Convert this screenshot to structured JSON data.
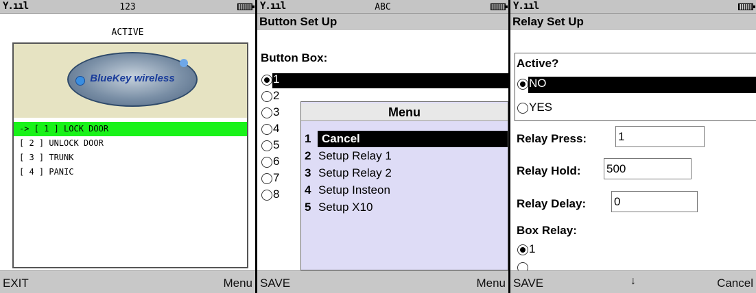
{
  "screens": [
    {
      "mode": "123",
      "title": "ACTIVE",
      "logo_text": "BlueKey wireless",
      "items": [
        "-> [ 1 ] LOCK DOOR",
        "[ 2 ] UNLOCK DOOR",
        "[ 3 ] TRUNK",
        "[ 4 ] PANIC"
      ],
      "softkeys": {
        "left": "EXIT",
        "right": "Menu"
      }
    },
    {
      "mode": "ABC",
      "header": "Button Set Up",
      "label": "Button Box:",
      "options": [
        "1",
        "2",
        "3",
        "4",
        "5",
        "6",
        "7",
        "8"
      ],
      "selected_option": "1",
      "menu": {
        "title": "Menu",
        "items": [
          {
            "num": "1",
            "label": "Cancel"
          },
          {
            "num": "2",
            "label": "Setup Relay 1"
          },
          {
            "num": "3",
            "label": "Setup Relay 2"
          },
          {
            "num": "4",
            "label": "Setup Insteon"
          },
          {
            "num": "5",
            "label": "Setup X10"
          }
        ]
      },
      "softkeys": {
        "left": "SAVE",
        "right": "Menu"
      }
    },
    {
      "header": "Relay Set Up",
      "active_label": "Active?",
      "active_options": [
        "NO",
        "YES"
      ],
      "relay_press_label": "Relay Press:",
      "relay_press_value": "1",
      "relay_hold_label": "Relay Hold:",
      "relay_hold_value": "500",
      "relay_delay_label": "Relay Delay:",
      "relay_delay_value": "0",
      "box_relay_label": "Box Relay:",
      "box_relay_option": "1",
      "softkeys": {
        "left": "SAVE",
        "middle": "↓",
        "right": "Cancel"
      }
    }
  ],
  "status": {
    "signal": "Y.ııl"
  }
}
